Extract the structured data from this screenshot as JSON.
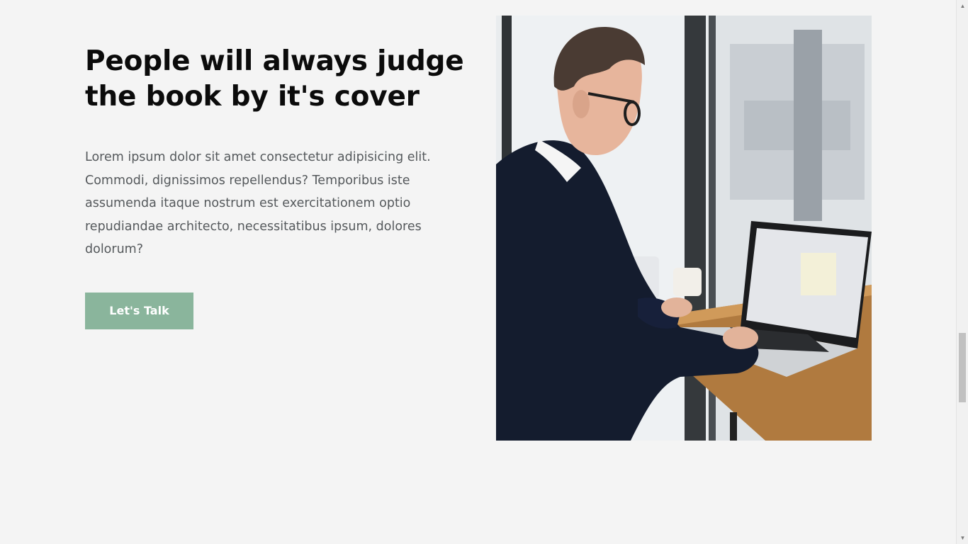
{
  "hero": {
    "headline": "People will always judge the book by it's cover",
    "body": "Lorem ipsum dolor sit amet consectetur adipisicing elit. Commodi, dignissimos repellendus? Temporibus iste assumenda itaque nostrum est exercitationem optio repudiandae architecto, necessitatibus ipsum, dolores dolorum?",
    "cta_label": "Let's Talk"
  },
  "colors": {
    "background": "#f4f4f4",
    "accent": "#8ab59c",
    "heading": "#0b0b0b",
    "body_text": "#55595c"
  },
  "scrollbar": {
    "up_icon": "scroll-up-arrow-icon",
    "down_icon": "scroll-down-arrow-icon",
    "position": 0.64
  }
}
